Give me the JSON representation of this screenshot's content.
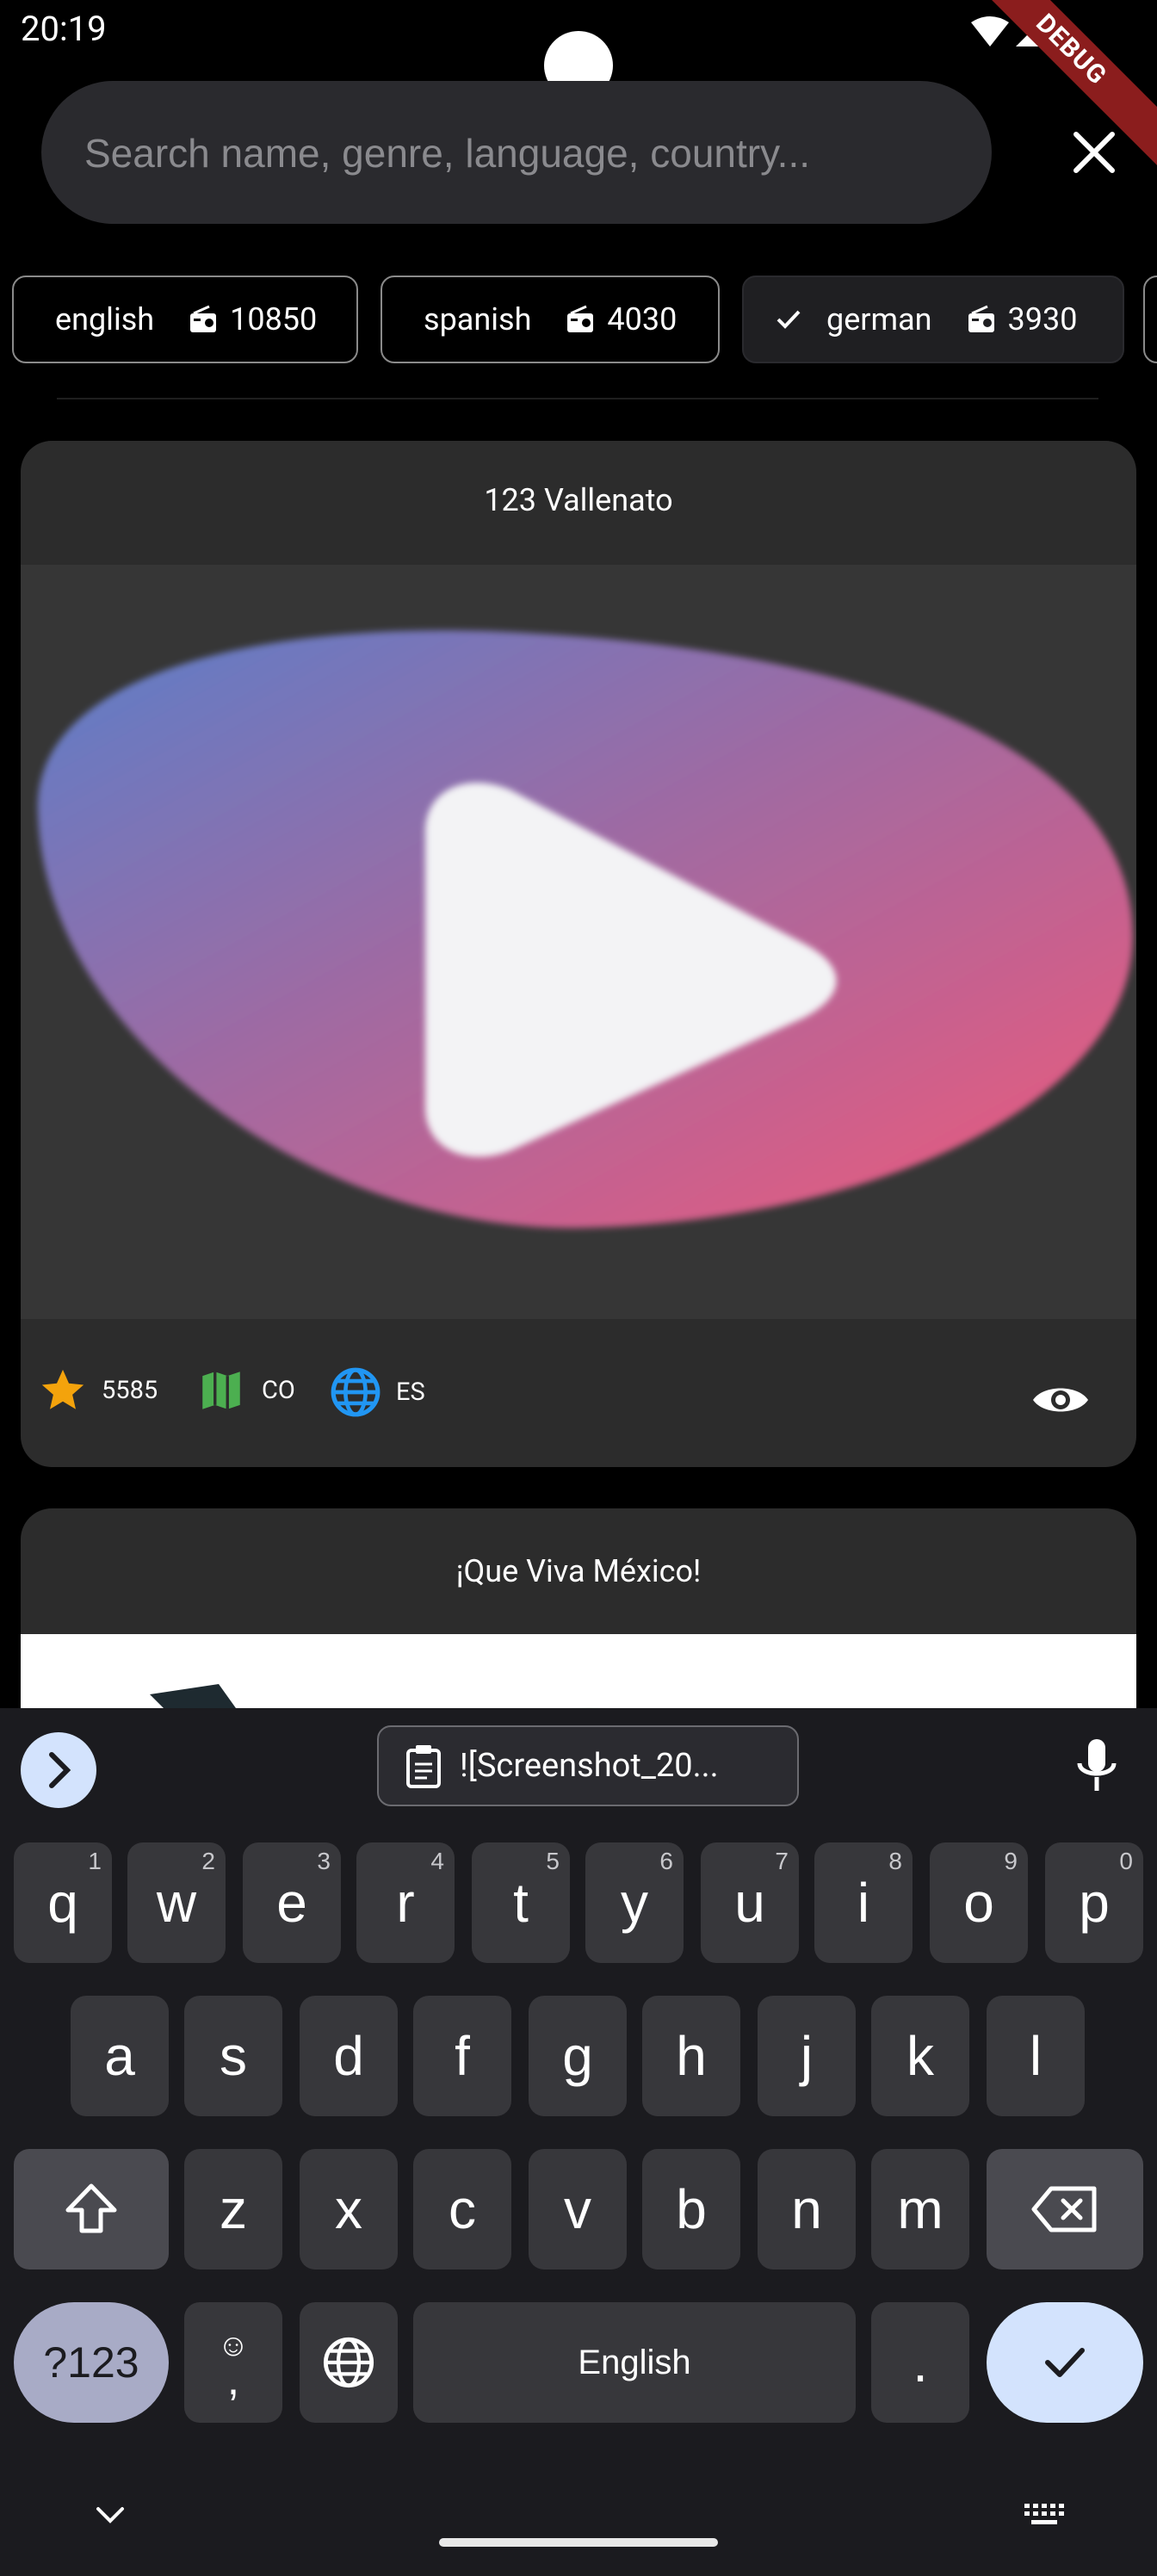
{
  "status_bar": {
    "time": "20:19",
    "debug_label": "DEBUG"
  },
  "search": {
    "placeholder": "Search name, genre, language, country...",
    "value": ""
  },
  "filters": [
    {
      "label": "english",
      "count": "10850",
      "selected": false
    },
    {
      "label": "spanish",
      "count": "4030",
      "selected": false
    },
    {
      "label": "german",
      "count": "3930",
      "selected": true
    }
  ],
  "stations": [
    {
      "name": "123 Vallenato",
      "votes": "5585",
      "country": "CO",
      "language": "ES",
      "star_color": "#f4a30c",
      "map_color": "#4caf50",
      "globe_color": "#2196f3"
    },
    {
      "name": "¡Que Viva México!"
    }
  ],
  "keyboard": {
    "clipboard_text": "![Screenshot_20...",
    "row1": [
      {
        "key": "q",
        "hint": "1"
      },
      {
        "key": "w",
        "hint": "2"
      },
      {
        "key": "e",
        "hint": "3"
      },
      {
        "key": "r",
        "hint": "4"
      },
      {
        "key": "t",
        "hint": "5"
      },
      {
        "key": "y",
        "hint": "6"
      },
      {
        "key": "u",
        "hint": "7"
      },
      {
        "key": "i",
        "hint": "8"
      },
      {
        "key": "o",
        "hint": "9"
      },
      {
        "key": "p",
        "hint": "0"
      }
    ],
    "row2": [
      "a",
      "s",
      "d",
      "f",
      "g",
      "h",
      "j",
      "k",
      "l"
    ],
    "row3": [
      "z",
      "x",
      "c",
      "v",
      "b",
      "n",
      "m"
    ],
    "symbols_label": "?123",
    "emoji_comma_top": "☺",
    "emoji_comma_bottom": ",",
    "space_label": "English",
    "period_label": "."
  }
}
